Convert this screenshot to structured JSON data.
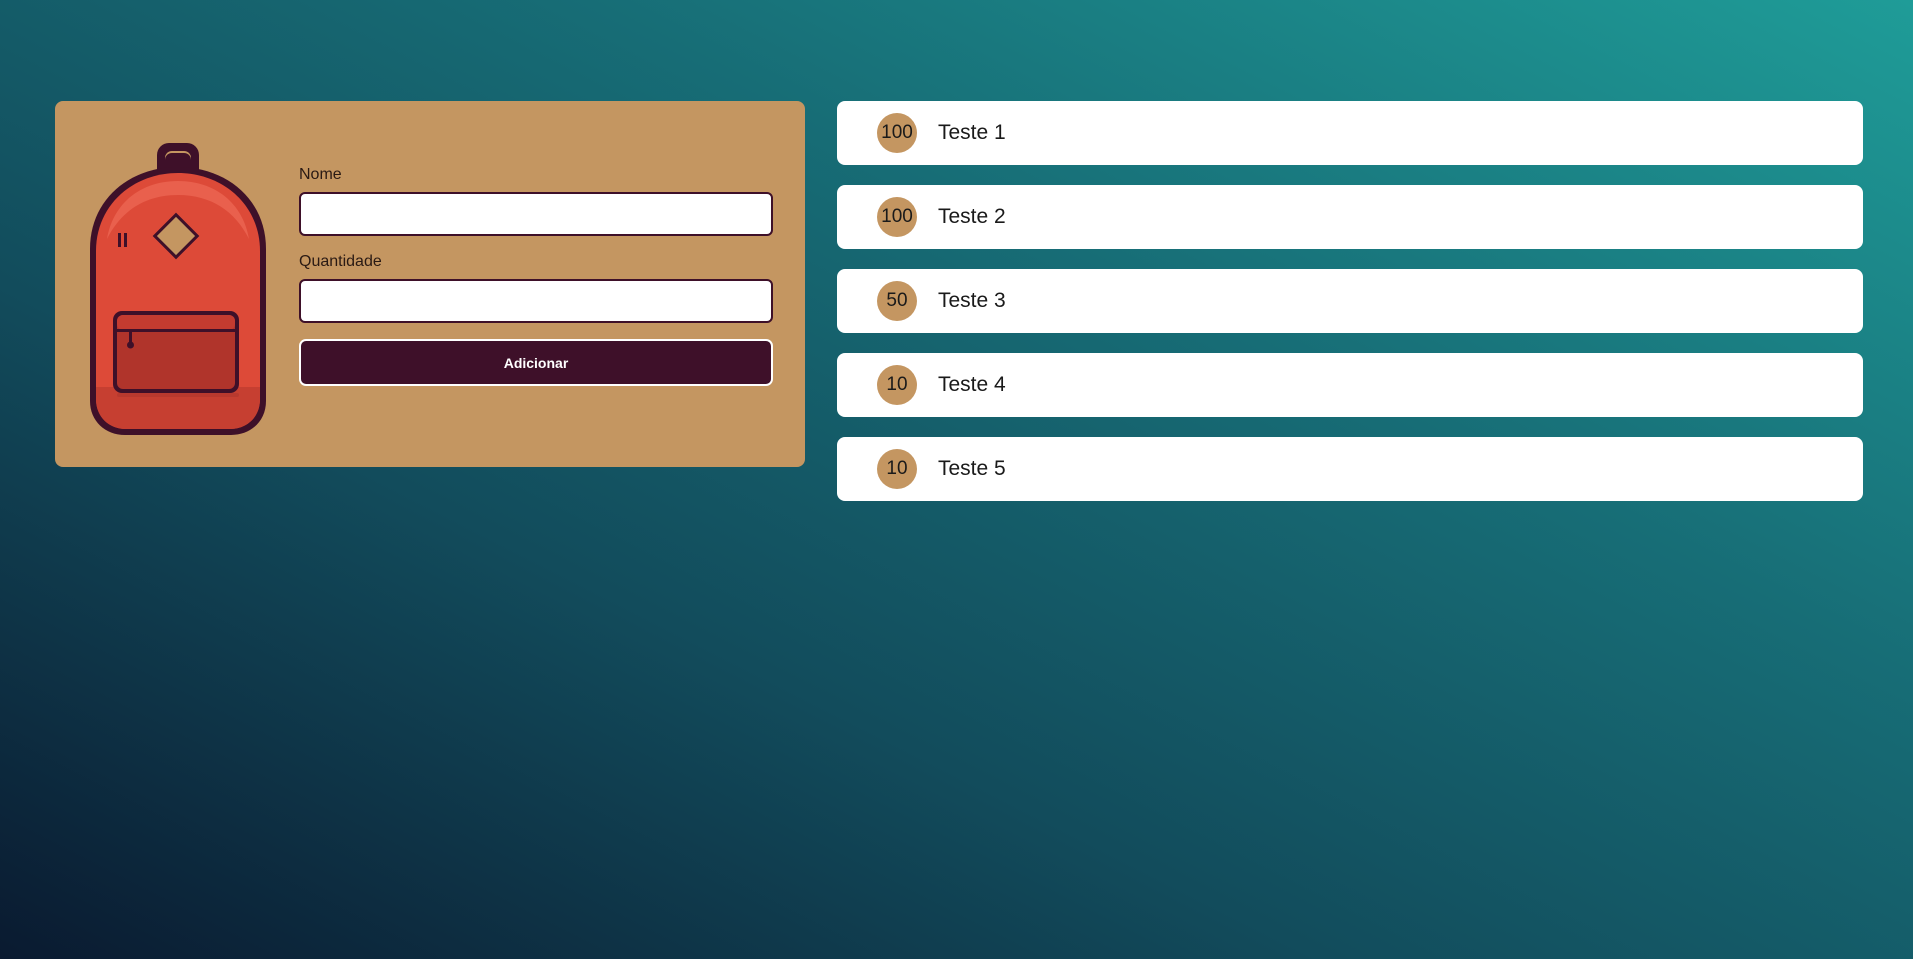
{
  "form": {
    "name_label": "Nome",
    "name_value": "",
    "quantity_label": "Quantidade",
    "quantity_value": "",
    "submit_label": "Adicionar"
  },
  "items": [
    {
      "quantity": "100",
      "name": "Teste 1"
    },
    {
      "quantity": "100",
      "name": "Teste 2"
    },
    {
      "quantity": "50",
      "name": "Teste 3"
    },
    {
      "quantity": "10",
      "name": "Teste 4"
    },
    {
      "quantity": "10",
      "name": "Teste 5"
    }
  ],
  "colors": {
    "card": "#c49661",
    "button": "#3e1029",
    "backpack_body": "#dd4a38",
    "backpack_outline": "#3e1029"
  },
  "icons": {
    "illustration": "backpack-icon"
  }
}
